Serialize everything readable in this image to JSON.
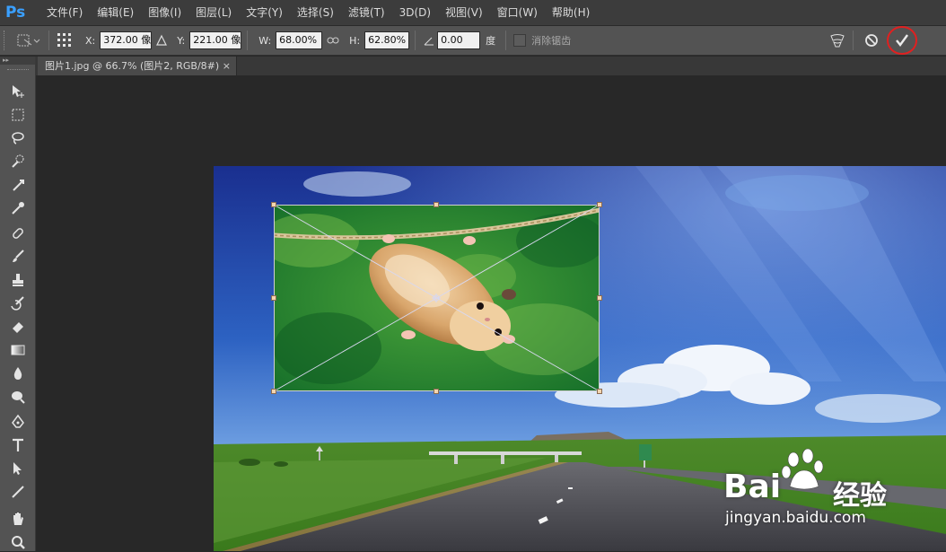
{
  "app": {
    "logo": "Ps"
  },
  "menu": [
    "文件(F)",
    "编辑(E)",
    "图像(I)",
    "图层(L)",
    "文字(Y)",
    "选择(S)",
    "滤镜(T)",
    "3D(D)",
    "视图(V)",
    "窗口(W)",
    "帮助(H)"
  ],
  "options": {
    "x_label": "X:",
    "x_value": "372.00 像",
    "y_label": "Y:",
    "y_value": "221.00 像",
    "w_label": "W:",
    "w_value": "68.00%",
    "h_label": "H:",
    "h_value": "62.80%",
    "angle_value": "0.00",
    "angle_unit": "度",
    "antialias_label": "消除锯齿",
    "antialias_checked": false
  },
  "document": {
    "tab_title": "图片1.jpg @ 66.7% (图片2, RGB/8#)",
    "close_glyph": "×"
  },
  "watermark": {
    "brand": "Bai",
    "brand_cn": "经验",
    "url": "jingyan.baidu.com"
  },
  "colors": {
    "accent_blue": "#3aa0ff",
    "highlight_circle": "#e02020"
  }
}
